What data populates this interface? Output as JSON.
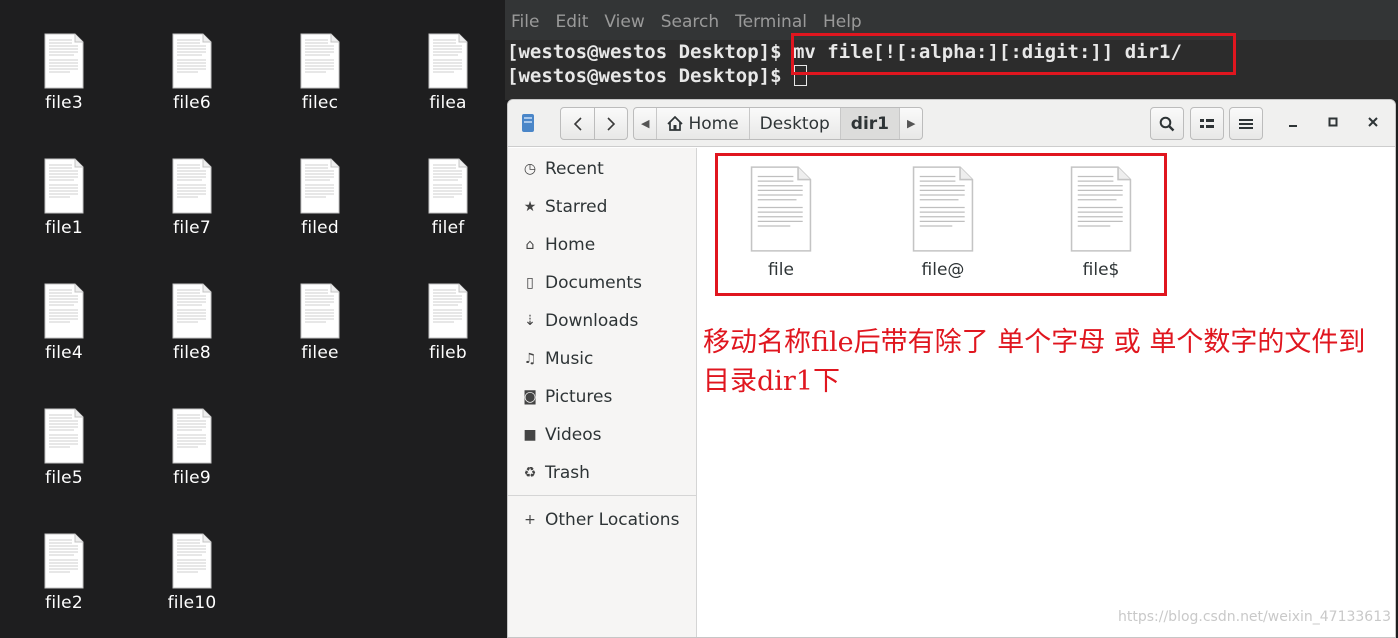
{
  "desktop": {
    "icons": [
      "file3",
      "file6",
      "filec",
      "filea",
      "file1",
      "file7",
      "filed",
      "filef",
      "file4",
      "file8",
      "filee",
      "fileb",
      "file5",
      "file9",
      "file2",
      "file10"
    ]
  },
  "terminal": {
    "menu": [
      "File",
      "Edit",
      "View",
      "Search",
      "Terminal",
      "Help"
    ],
    "prompt": "[westos@westos Desktop]$",
    "command": " mv file[![:alpha:][:digit:]] dir1/"
  },
  "file_manager": {
    "breadcrumb": [
      "Home",
      "Desktop",
      "dir1"
    ],
    "sidebar": [
      "Recent",
      "Starred",
      "Home",
      "Documents",
      "Downloads",
      "Music",
      "Pictures",
      "Videos",
      "Trash",
      "Other Locations"
    ],
    "files": [
      "file",
      "file@",
      "file$"
    ],
    "annotation": "移动名称file后带有除了 单个字母 或 单个数字的文件到目录dir1下"
  },
  "watermark": "https://blog.csdn.net/weixin_47133613",
  "colors": {
    "highlight": "#e0161f",
    "desktop_bg": "#1e1e1f",
    "terminal_bg": "#2c2c2c"
  }
}
